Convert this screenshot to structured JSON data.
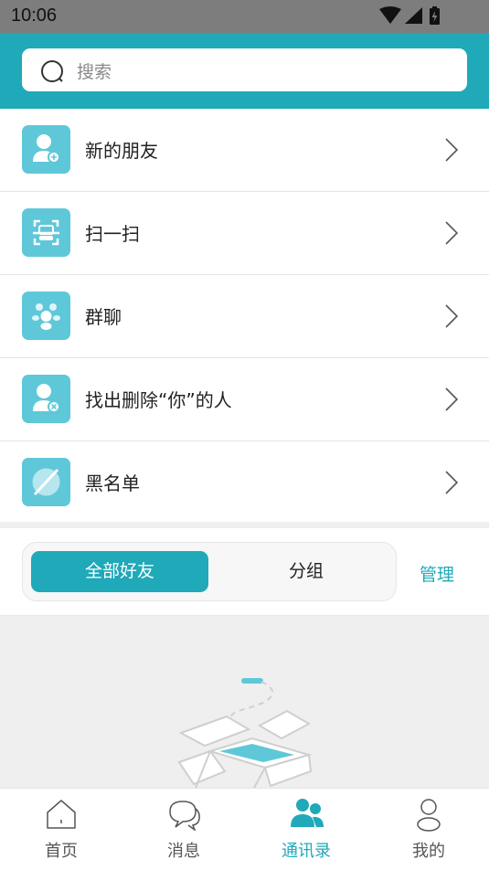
{
  "status_bar": {
    "time": "10:06"
  },
  "search": {
    "placeholder": "搜索"
  },
  "menu": {
    "items": [
      {
        "label": "新的朋友",
        "icon": "add-friend-icon"
      },
      {
        "label": "扫一扫",
        "icon": "scan-icon"
      },
      {
        "label": "群聊",
        "icon": "group-chat-icon"
      },
      {
        "label": "找出删除“你”的人",
        "icon": "find-deleted-friend-icon"
      },
      {
        "label": "黑名单",
        "icon": "blacklist-icon"
      }
    ]
  },
  "segment": {
    "all_friends": "全部好友",
    "groups": "分组",
    "manage": "管理"
  },
  "tabbar": {
    "items": [
      {
        "label": "首页",
        "active": false
      },
      {
        "label": "消息",
        "active": false
      },
      {
        "label": "通讯录",
        "active": true
      },
      {
        "label": "我的",
        "active": false
      }
    ]
  },
  "colors": {
    "accent": "#1fa9b9",
    "icon_bg": "#5ec8d9",
    "status_bar": "#7d7d7d"
  }
}
